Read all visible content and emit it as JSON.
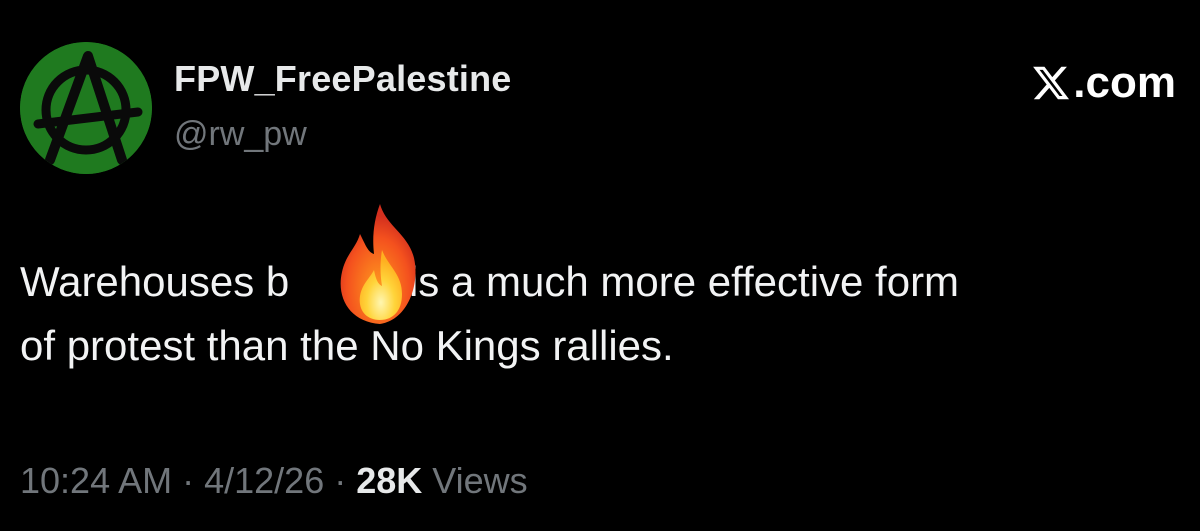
{
  "author": {
    "display_name": "FPW_FreePalestine",
    "handle": "@rw_pw",
    "avatar_icon": "anarchy-symbol-icon",
    "avatar_color": "#1f7a1f"
  },
  "brand": {
    "logo_icon": "x-logo-icon",
    "text": ".com"
  },
  "tweet": {
    "line1_before": "Warehouses b",
    "line1_after": "ing is a much more effective form",
    "line2": "of protest than the No Kings rallies.",
    "emoji_icon": "fire-emoji-icon"
  },
  "meta": {
    "time": "10:24 AM",
    "sep1": " · ",
    "date": "4/12/26",
    "sep2": " · ",
    "views_count": "28K",
    "views_label": " Views"
  },
  "colors": {
    "background": "#000000",
    "primary_text": "#e7e9ea",
    "secondary_text": "#71767b"
  }
}
